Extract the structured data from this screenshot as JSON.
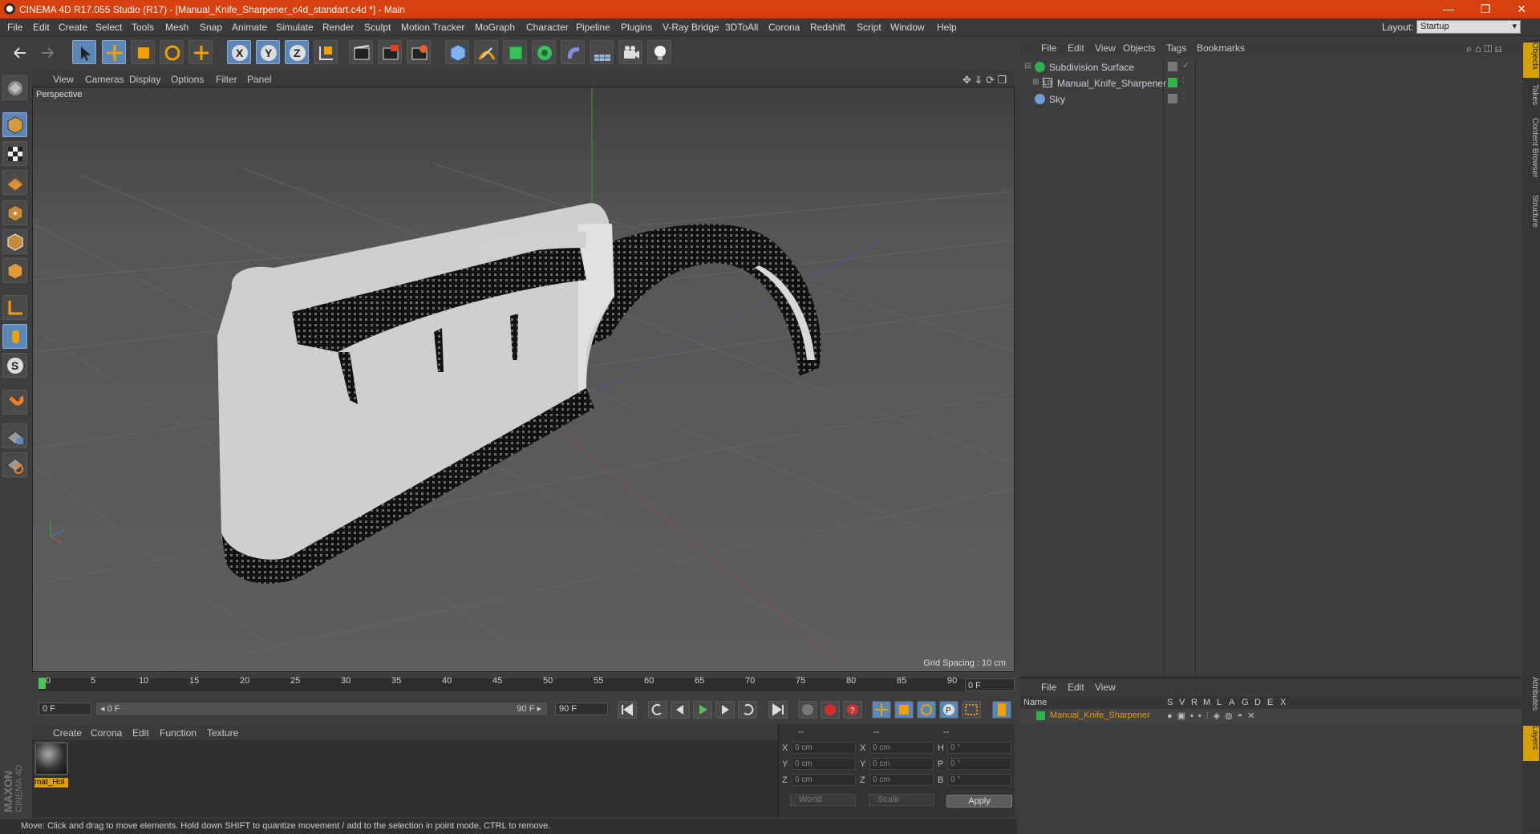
{
  "window": {
    "title": "CINEMA 4D R17.055 Studio (R17) - [Manual_Knife_Sharpener_c4d_standart.c4d *] - Main",
    "minimize": "—",
    "restore": "❐",
    "close": "✕"
  },
  "menubar": [
    "File",
    "Edit",
    "Create",
    "Select",
    "Tools",
    "Mesh",
    "Snap",
    "Animate",
    "Simulate",
    "Render",
    "Sculpt",
    "Motion Tracker",
    "MoGraph",
    "Character",
    "Pipeline",
    "Plugins",
    "V-Ray Bridge",
    "3DToAll",
    "Corona",
    "Redshift",
    "Script",
    "Window",
    "Help"
  ],
  "layout": {
    "label": "Layout:",
    "value": "Startup"
  },
  "main_toolbar_icons": [
    "undo-icon",
    "redo-icon",
    "select-icon",
    "move-icon",
    "scale-icon",
    "rotate-icon",
    "transform-icon",
    "x-axis-icon",
    "y-axis-icon",
    "z-axis-icon",
    "world-coords-icon",
    "render-view-icon",
    "render-picture-viewer-icon",
    "render-settings-icon",
    "cube-icon",
    "pen-icon",
    "subdivision-icon",
    "array-icon",
    "deformer-icon",
    "floor-icon",
    "camera-icon",
    "light-icon"
  ],
  "left_toolbar_icons": [
    "make-editable-icon",
    "model-mode-icon",
    "texture-mode-icon",
    "workplane-icon",
    "points-mode-icon",
    "edges-mode-icon",
    "polygons-mode-icon",
    "axis-mode-icon",
    "tweak-icon",
    "snapping-icon",
    "magnet-icon",
    "grid-lock-icon",
    "enable-snap-icon"
  ],
  "viewport": {
    "menu": [
      "View",
      "Cameras",
      "Display",
      "Options",
      "Filter",
      "Panel"
    ],
    "label": "Perspective",
    "grid_spacing": "Grid Spacing : 10 cm"
  },
  "timeline": {
    "ticks": [
      "0",
      "5",
      "10",
      "15",
      "20",
      "25",
      "30",
      "35",
      "40",
      "45",
      "50",
      "55",
      "60",
      "65",
      "70",
      "75",
      "80",
      "85",
      "90"
    ],
    "current_frame": "0 F",
    "start_field": "0 F",
    "range_start": "◂ 0 F",
    "range_end": "90 F ▸",
    "end_field": "90 F"
  },
  "material_manager": {
    "menu": [
      "Create",
      "Corona",
      "Edit",
      "Function",
      "Texture"
    ],
    "material_name": "mat_Hol"
  },
  "coordinates": {
    "headers": [
      "--",
      "--",
      "--"
    ],
    "rows": [
      {
        "a": "X",
        "av": "0 cm",
        "b": "X",
        "bv": "0 cm",
        "c": "H",
        "cv": "0 °"
      },
      {
        "a": "Y",
        "av": "0 cm",
        "b": "Y",
        "bv": "0 cm",
        "c": "P",
        "cv": "0 °"
      },
      {
        "a": "Z",
        "av": "0 cm",
        "b": "Z",
        "bv": "0 cm",
        "c": "B",
        "cv": "0 °"
      }
    ],
    "mode1": "World",
    "mode2": "Scale",
    "apply": "Apply"
  },
  "status": "Move: Click and drag to move elements. Hold down SHIFT to quantize movement / add to the selection in point mode, CTRL to remove.",
  "brand": {
    "maxon": "MAXON",
    "c4d": "CINEMA 4D"
  },
  "object_manager": {
    "menu": [
      "File",
      "Edit",
      "View",
      "Objects",
      "Tags",
      "Bookmarks"
    ],
    "objects": [
      {
        "name": "Subdivision Surface",
        "icon_color": "#2fb34a"
      },
      {
        "name": "Manual_Knife_Sharpener",
        "icon_color": "#888888"
      },
      {
        "name": "Sky",
        "icon_color": "#6f9bd6"
      }
    ]
  },
  "side_tabs": [
    "Objects",
    "Takes",
    "Content Browser",
    "Structure"
  ],
  "side_tabs_lower": [
    "Attributes",
    "Layers"
  ],
  "layer_manager": {
    "menu": [
      "File",
      "Edit",
      "View"
    ],
    "columns": [
      "Name",
      "S",
      "V",
      "R",
      "M",
      "L",
      "A",
      "G",
      "D",
      "E",
      "X"
    ],
    "layer_name": "Manual_Knife_Sharpener",
    "layer_color": "#2fb34a"
  },
  "colors": {
    "titlebar": "#d8400e",
    "accent_blue": "#5b86b8",
    "highlight": "#e0a000"
  }
}
